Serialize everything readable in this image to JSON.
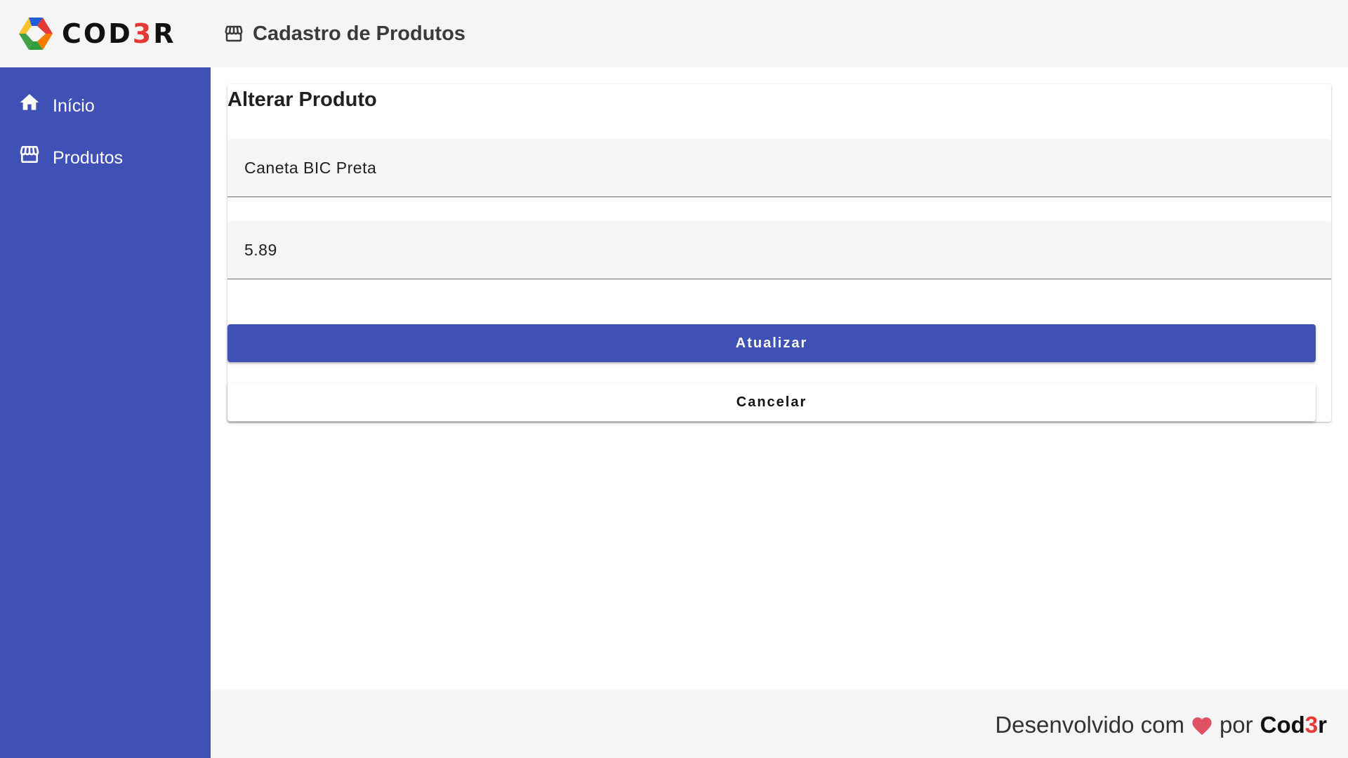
{
  "header": {
    "logo_text_prefix": "COD",
    "logo_text_three": "3",
    "logo_text_suffix": "R",
    "page_title": "Cadastro de Produtos"
  },
  "sidebar": {
    "items": [
      {
        "label": "Início",
        "icon": "home-icon"
      },
      {
        "label": "Produtos",
        "icon": "store-icon"
      }
    ]
  },
  "form": {
    "title": "Alterar Produto",
    "name_value": "Caneta BIC Preta",
    "price_value": "5.89",
    "update_label": "Atualizar",
    "cancel_label": "Cancelar"
  },
  "footer": {
    "text": "Desenvolvido com",
    "by": "por",
    "brand_prefix": "Cod",
    "brand_three": "3",
    "brand_suffix": "r"
  },
  "colors": {
    "primary": "#3f51b5",
    "header_bg": "#f5f5f5",
    "heart": "#e05263",
    "brand_red": "#e53935"
  }
}
